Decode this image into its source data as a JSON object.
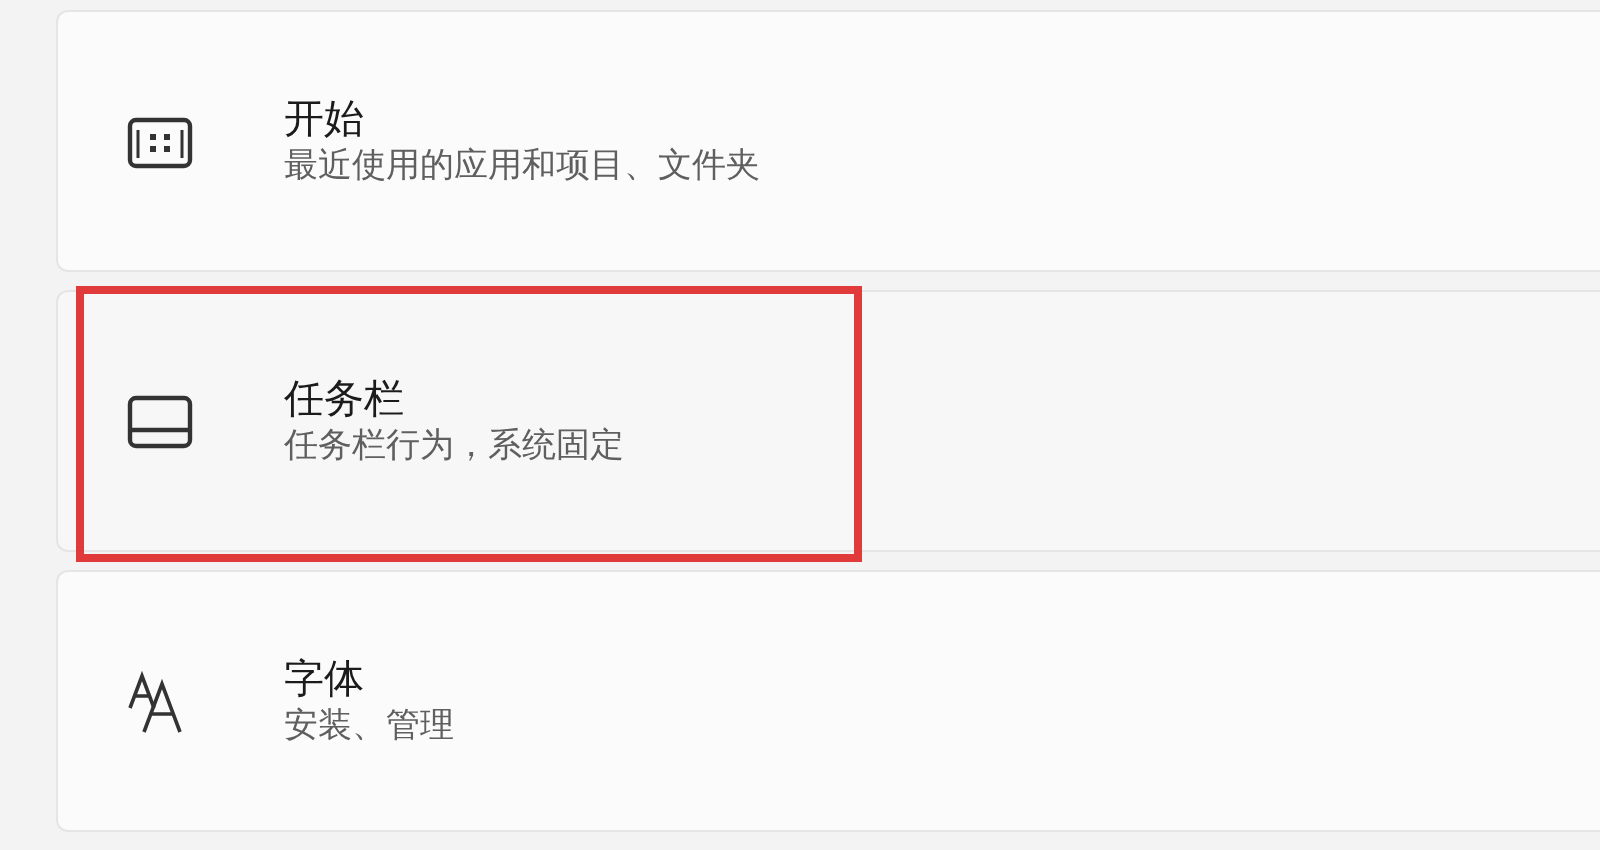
{
  "items": [
    {
      "kind": "start",
      "title": "开始",
      "subtitle": "最近使用的应用和项目、文件夹",
      "highlighted": false
    },
    {
      "kind": "taskbar",
      "title": "任务栏",
      "subtitle": "任务栏行为，系统固定",
      "highlighted": true
    },
    {
      "kind": "fonts",
      "title": "字体",
      "subtitle": "安装、管理",
      "highlighted": false
    }
  ]
}
